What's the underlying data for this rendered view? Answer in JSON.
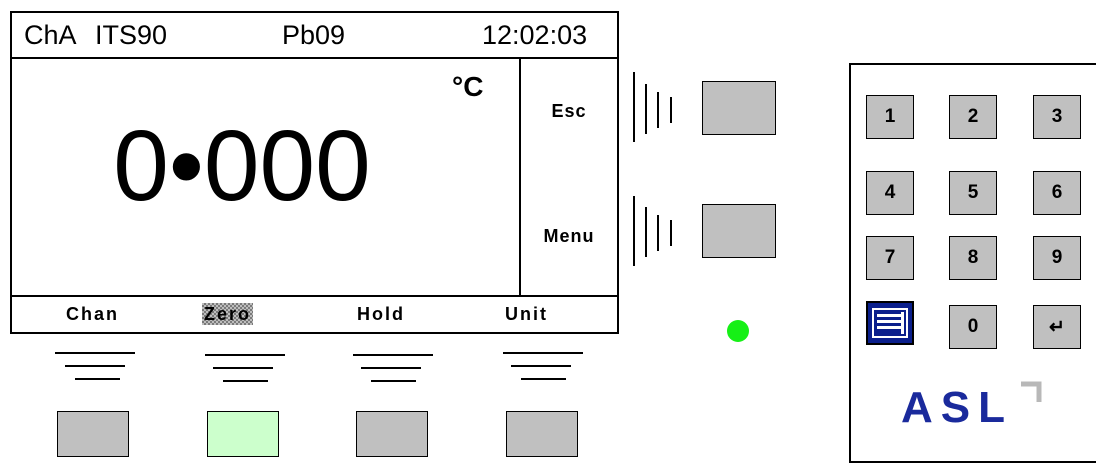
{
  "display": {
    "channel": "ChA",
    "scale": "ITS90",
    "probe": "Pb09",
    "clock": "12:02:03",
    "unit": "°C",
    "reading": "0•000"
  },
  "side_menu": [
    {
      "label": "Esc"
    },
    {
      "label": "Menu"
    }
  ],
  "softkeys": [
    {
      "label": "Chan"
    },
    {
      "label": "Zero",
      "selected": true
    },
    {
      "label": "Hold"
    },
    {
      "label": "Unit"
    }
  ],
  "keypad": {
    "keys": [
      "1",
      "2",
      "3",
      "4",
      "5",
      "6",
      "7",
      "8",
      "9",
      "",
      "0",
      "↵"
    ],
    "logo": "ASL"
  },
  "colors": {
    "led": "#16f016",
    "active_softkey_button": "#ccffcc",
    "button_gray": "#c0c0c0",
    "logo_blue": "#1a2a9c",
    "menu_key": "#0b1f8c"
  },
  "icons": {
    "menu_key": "document-list-icon",
    "enter_key": "enter-arrow-icon",
    "logo_mark": "corner-bracket-icon"
  }
}
